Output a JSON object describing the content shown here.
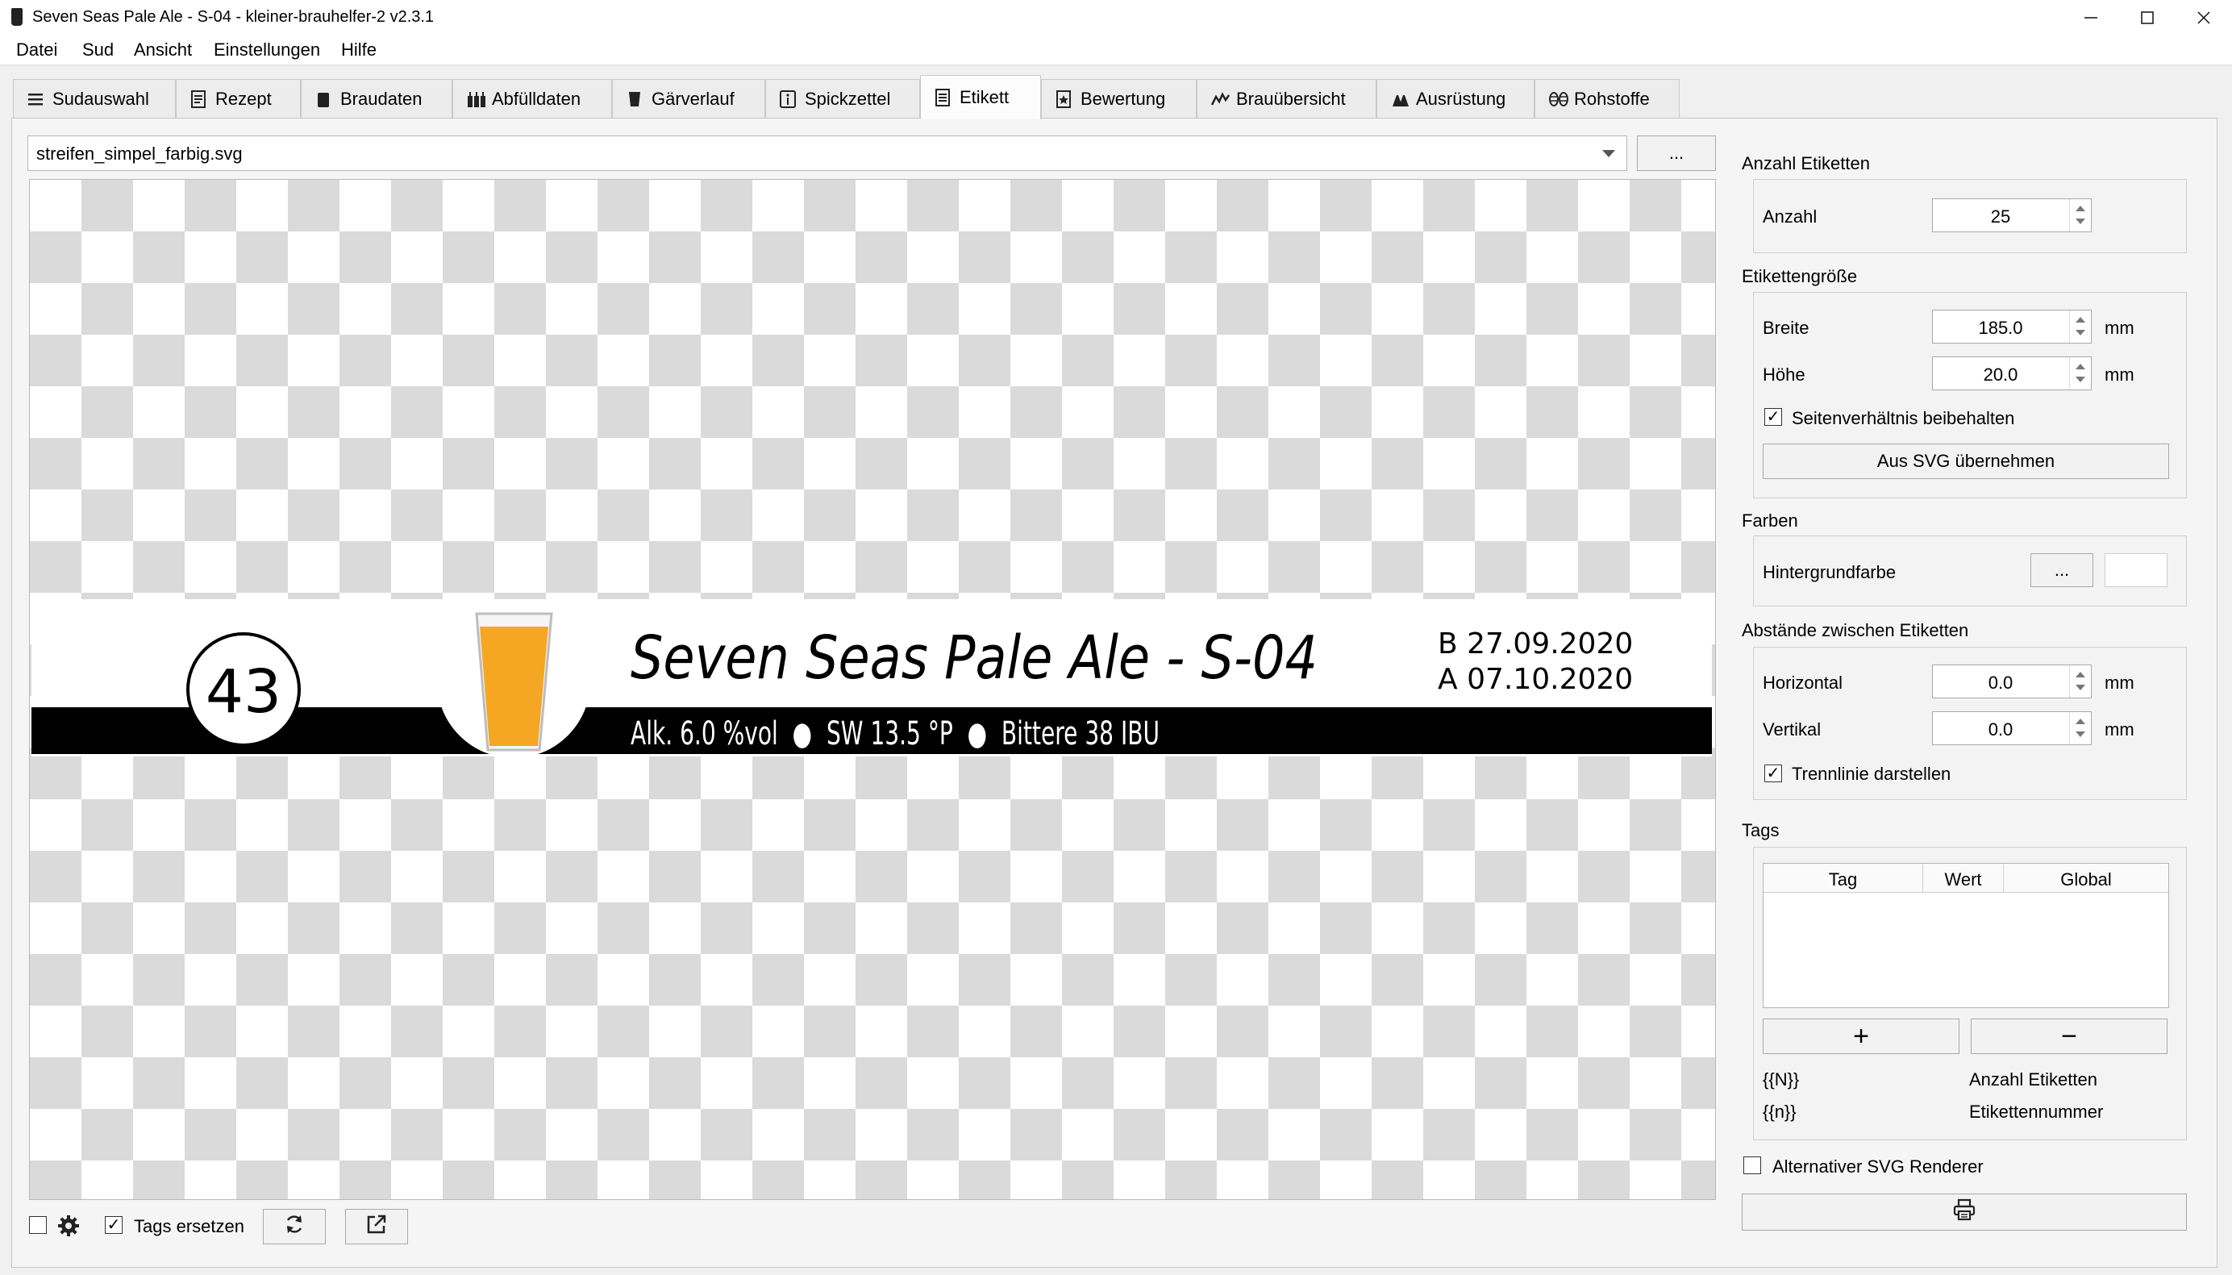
{
  "window": {
    "title": "Seven Seas Pale Ale - S-04 - kleiner-brauhelfer-2 v2.3.1"
  },
  "menu": [
    "Datei",
    "Sud",
    "Ansicht",
    "Einstellungen",
    "Hilfe"
  ],
  "tabs": [
    {
      "label": "Sudauswahl",
      "icon": "list-icon"
    },
    {
      "label": "Rezept",
      "icon": "recipe-icon"
    },
    {
      "label": "Braudaten",
      "icon": "kettle-icon"
    },
    {
      "label": "Abfülldaten",
      "icon": "bottles-icon"
    },
    {
      "label": "Gärverlauf",
      "icon": "fermenter-icon"
    },
    {
      "label": "Spickzettel",
      "icon": "info-icon"
    },
    {
      "label": "Etikett",
      "icon": "document-icon"
    },
    {
      "label": "Bewertung",
      "icon": "star-icon"
    },
    {
      "label": "Brauübersicht",
      "icon": "chart-icon"
    },
    {
      "label": "Ausrüstung",
      "icon": "equipment-icon"
    },
    {
      "label": "Rohstoffe",
      "icon": "hops-icon"
    }
  ],
  "active_tab": "Etikett",
  "file_selector": {
    "value": "streifen_simpel_farbig.svg",
    "browse_label": "..."
  },
  "label_preview": {
    "number": "43",
    "title": "Seven Seas Pale Ale - S-04",
    "date_b": "B 27.09.2020",
    "date_a": "A 07.10.2020",
    "stats": "Alk. 6.0 %vol  ●  SW 13.5 °P  ●  Bittere 38 IBU",
    "strip_color": "#000000",
    "beer_color": "#f5a623"
  },
  "panel": {
    "count_group": {
      "title": "Anzahl Etiketten",
      "label": "Anzahl",
      "value": "25"
    },
    "size_group": {
      "title": "Etikettengröße",
      "width_label": "Breite",
      "width_value": "185.0",
      "height_label": "Höhe",
      "height_value": "20.0",
      "unit": "mm",
      "keep_ratio_label": "Seitenverhältnis beibehalten",
      "keep_ratio_checked": true,
      "from_svg_button": "Aus SVG übernehmen"
    },
    "colors_group": {
      "title": "Farben",
      "bg_label": "Hintergrundfarbe",
      "picker_label": "...",
      "bg_color": "#ffffff"
    },
    "spacing_group": {
      "title": "Abstände zwischen Etiketten",
      "horizontal_label": "Horizontal",
      "horizontal_value": "0.0",
      "vertical_label": "Vertikal",
      "vertical_value": "0.0",
      "unit": "mm",
      "separator_label": "Trennlinie darstellen",
      "separator_checked": true
    },
    "tags_group": {
      "title": "Tags",
      "columns": [
        "Tag",
        "Wert",
        "Global"
      ],
      "rows": [],
      "add_label": "+",
      "remove_label": "−",
      "legend": [
        {
          "key": "{{N}}",
          "desc": "Anzahl Etiketten"
        },
        {
          "key": "{{n}}",
          "desc": "Etikettennummer"
        }
      ]
    },
    "alt_renderer_label": "Alternativer SVG Renderer",
    "alt_renderer_checked": false
  },
  "bottom_bar": {
    "settings_checked": false,
    "replace_tags_label": "Tags ersetzen",
    "replace_tags_checked": true
  }
}
